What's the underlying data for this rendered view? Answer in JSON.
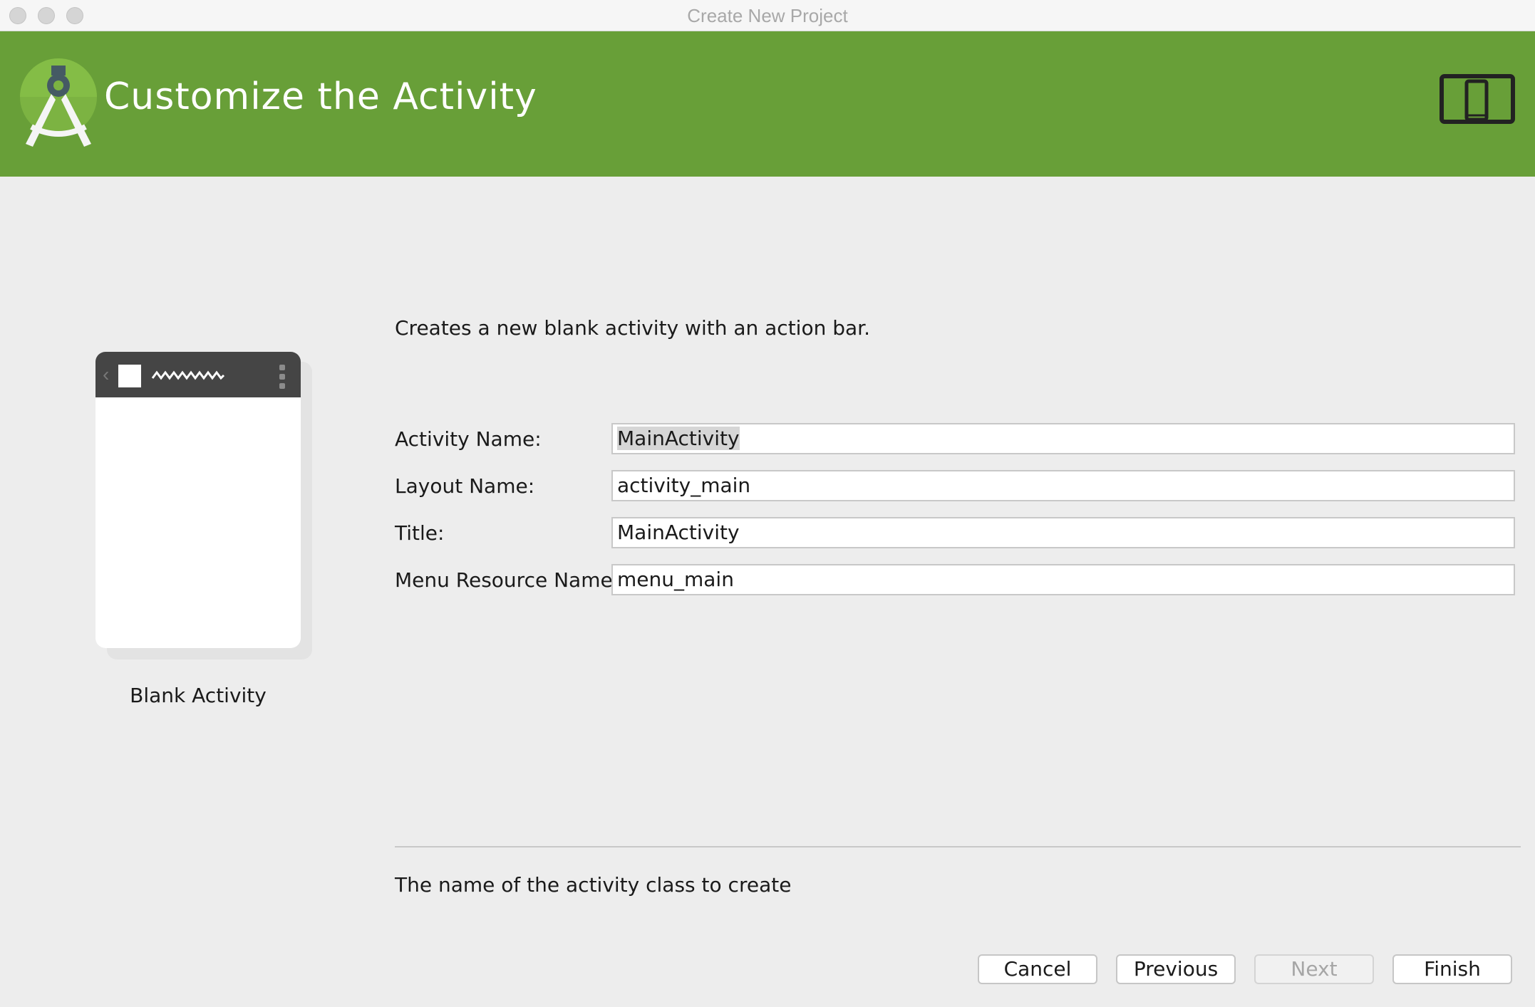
{
  "window": {
    "title": "Create New Project"
  },
  "header": {
    "title": "Customize the Activity",
    "logo_icon": "android-studio-logo-icon",
    "device_icon": "tablet-phone-icon",
    "background_color": "#689f38"
  },
  "preview": {
    "label": "Blank Activity",
    "back_glyph": "‹"
  },
  "form": {
    "description": "Creates a new blank activity with an action bar.",
    "fields": [
      {
        "label": "Activity Name:",
        "value": "MainActivity",
        "focused": true
      },
      {
        "label": "Layout Name:",
        "value": "activity_main"
      },
      {
        "label": "Title:",
        "value": "MainActivity"
      },
      {
        "label": "Menu Resource Name:",
        "value": "menu_main"
      }
    ],
    "hint": "The name of the activity class to create"
  },
  "buttons": {
    "cancel": "Cancel",
    "previous": "Previous",
    "next": "Next",
    "finish": "Finish"
  }
}
